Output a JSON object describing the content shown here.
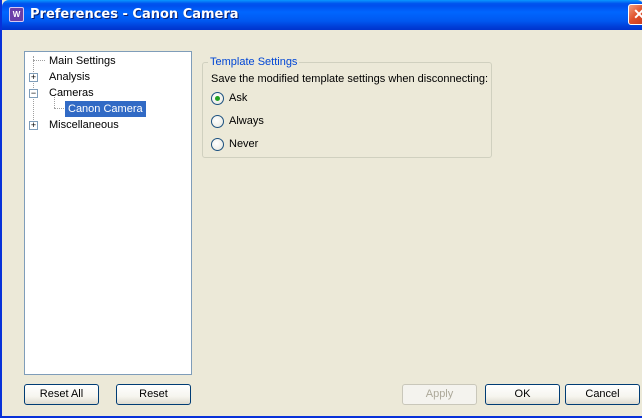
{
  "window": {
    "title": "Preferences - Canon Camera",
    "icon": "app-icon",
    "close_glyph": "✕"
  },
  "tree": {
    "items": [
      {
        "label": "Main Settings",
        "expander": ""
      },
      {
        "label": "Analysis",
        "expander": "+"
      },
      {
        "label": "Cameras",
        "expander": "−"
      },
      {
        "label": "Canon Camera",
        "expander": "",
        "selected": true
      },
      {
        "label": "Miscellaneous",
        "expander": "+"
      }
    ]
  },
  "template_settings": {
    "legend": "Template Settings",
    "description": "Save the modified template settings when disconnecting:",
    "options": [
      {
        "label": "Ask",
        "checked": true
      },
      {
        "label": "Always",
        "checked": false
      },
      {
        "label": "Never",
        "checked": false
      }
    ]
  },
  "buttons": {
    "reset_all": "Reset All",
    "reset": "Reset",
    "apply": "Apply",
    "ok": "OK",
    "cancel": "Cancel"
  },
  "colors": {
    "titlebar": "#0053ee",
    "selection": "#316ac5",
    "legend_text": "#0046d5",
    "dialog_bg": "#ece9d8"
  }
}
